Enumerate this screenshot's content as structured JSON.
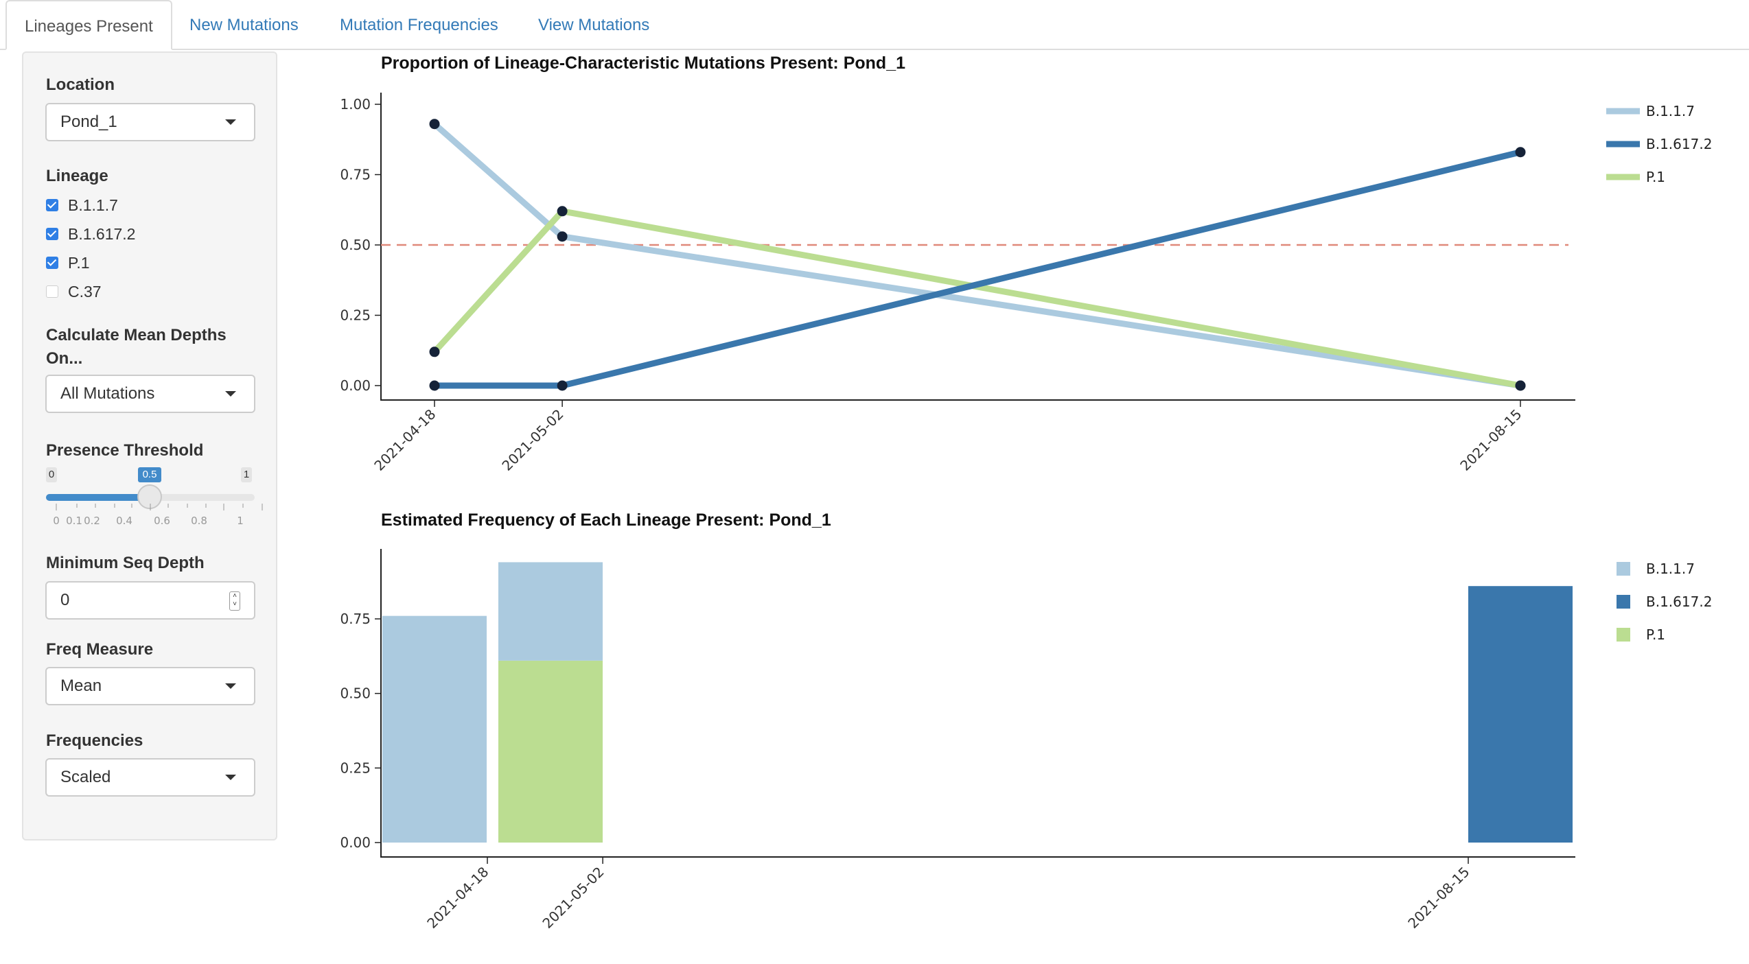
{
  "tabs": [
    "Lineages Present",
    "New Mutations",
    "Mutation Frequencies",
    "View Mutations"
  ],
  "sidebar": {
    "location_label": "Location",
    "location_value": "Pond_1",
    "lineage_label": "Lineage",
    "lineages": [
      {
        "label": "B.1.1.7",
        "checked": true
      },
      {
        "label": "B.1.617.2",
        "checked": true
      },
      {
        "label": "P.1",
        "checked": true
      },
      {
        "label": "C.37",
        "checked": false
      }
    ],
    "mean_depth_label_line1": "Calculate Mean Depths",
    "mean_depth_label_line2": "On...",
    "mean_depth_value": "All Mutations",
    "threshold_label": "Presence Threshold",
    "threshold_min": "0",
    "threshold_max": "1",
    "threshold_value": "0.5",
    "threshold_ticks": [
      "0",
      "0.1",
      "0.2",
      "0.4",
      "0.6",
      "0.8",
      "1"
    ],
    "min_depth_label": "Minimum Seq Depth",
    "min_depth_value": "0",
    "freq_measure_label": "Freq Measure",
    "freq_measure_value": "Mean",
    "frequencies_label": "Frequencies",
    "frequencies_value": "Scaled"
  },
  "colors": {
    "B.1.1.7": "#abcadf",
    "B.1.617.2": "#3a77ac",
    "P.1": "#bbdd91",
    "threshold_line": "#e0897a",
    "points": "#152238"
  },
  "chart_data": [
    {
      "type": "line",
      "title": "Proportion of Lineage-Characteristic Mutations Present: Pond_1",
      "x": [
        "2021-04-18",
        "2021-05-02",
        "2021-08-15"
      ],
      "ylim": [
        0,
        1.05
      ],
      "yticks": [
        "0.00",
        "0.25",
        "0.50",
        "0.75",
        "1.00"
      ],
      "threshold": 0.5,
      "legend": "right",
      "series": [
        {
          "name": "B.1.1.7",
          "values": [
            0.93,
            0.53,
            0.0
          ]
        },
        {
          "name": "B.1.617.2",
          "values": [
            0.0,
            0.0,
            0.83
          ]
        },
        {
          "name": "P.1",
          "values": [
            0.12,
            0.62,
            0.0
          ]
        }
      ]
    },
    {
      "type": "bar",
      "title": "Estimated Frequency of Each Lineage Present: Pond_1",
      "x": [
        "2021-04-18",
        "2021-05-02",
        "2021-08-15"
      ],
      "ylim": [
        0,
        1.0
      ],
      "yticks": [
        "0.00",
        "0.25",
        "0.50",
        "0.75"
      ],
      "legend": "right",
      "series": [
        {
          "name": "B.1.1.7",
          "values": [
            0.76,
            0.33,
            0
          ]
        },
        {
          "name": "B.1.617.2",
          "values": [
            0,
            0,
            0.86
          ]
        },
        {
          "name": "P.1",
          "values": [
            0,
            0.61,
            0
          ]
        }
      ]
    }
  ]
}
